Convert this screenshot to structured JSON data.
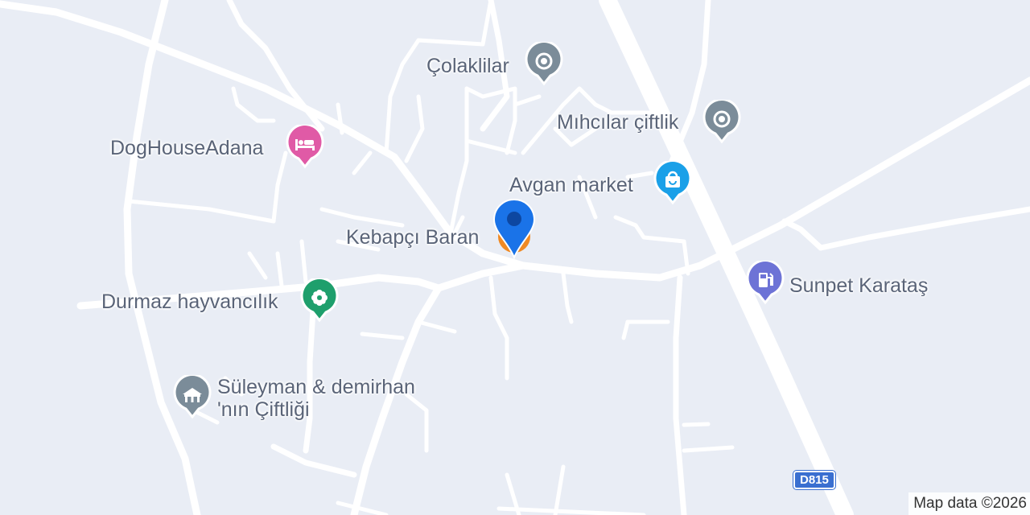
{
  "map": {
    "route_badge": "D815",
    "attribution": "Map data ©2026",
    "selected_marker": {
      "name": "Kebapçı Baran",
      "color": "#1a73e8"
    },
    "pois": [
      {
        "id": "colaklilar",
        "label": "Çolaklilar",
        "icon": "place-icon",
        "color": "#7b8c99"
      },
      {
        "id": "mihcilar",
        "label": "Mıhcılar çiftlik",
        "icon": "place-icon",
        "color": "#7b8c99"
      },
      {
        "id": "doghouse",
        "label": "DogHouseAdana",
        "icon": "hotel-bed-icon",
        "color": "#e05aa6"
      },
      {
        "id": "avgan",
        "label": "Avgan market",
        "icon": "shopping-bag-icon",
        "color": "#1aa0e8"
      },
      {
        "id": "kebapci",
        "label": "Kebapçı Baran",
        "icon": "restaurant-icon",
        "color": "#f08a24"
      },
      {
        "id": "durmaz",
        "label": "Durmaz hayvancılık",
        "icon": "flower-icon",
        "color": "#1e9f6c"
      },
      {
        "id": "sunpet",
        "label": "Sunpet Karataş",
        "icon": "gas-station-icon",
        "color": "#6d73d6"
      },
      {
        "id": "suleyman",
        "label": "Süleyman & demirhan\n'nın Çiftliği",
        "icon": "farm-icon",
        "color": "#7b8c99"
      }
    ]
  }
}
